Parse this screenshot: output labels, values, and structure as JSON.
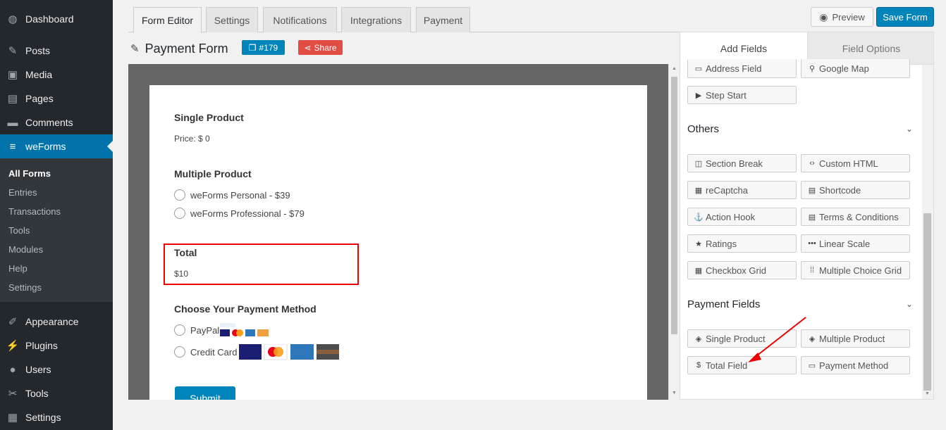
{
  "sidebar": {
    "items": [
      {
        "label": "Dashboard",
        "icon": "dashboard-icon",
        "glyph": "◍"
      },
      {
        "label": "Posts",
        "icon": "pin-icon",
        "glyph": "✎"
      },
      {
        "label": "Media",
        "icon": "media-icon",
        "glyph": "▣"
      },
      {
        "label": "Pages",
        "icon": "page-icon",
        "glyph": "▤"
      },
      {
        "label": "Comments",
        "icon": "comment-icon",
        "glyph": "▬"
      },
      {
        "label": "weForms",
        "icon": "weforms-icon",
        "glyph": "≡"
      }
    ],
    "submenu": [
      "All Forms",
      "Entries",
      "Transactions",
      "Tools",
      "Modules",
      "Help",
      "Settings"
    ],
    "lower_items": [
      {
        "label": "Appearance",
        "icon": "brush-icon",
        "glyph": "✐"
      },
      {
        "label": "Plugins",
        "icon": "plugin-icon",
        "glyph": "⚡"
      },
      {
        "label": "Users",
        "icon": "user-icon",
        "glyph": "●"
      },
      {
        "label": "Tools",
        "icon": "wrench-icon",
        "glyph": "✂"
      },
      {
        "label": "Settings",
        "icon": "settings-icon",
        "glyph": "▦"
      }
    ]
  },
  "tabs": [
    "Form Editor",
    "Settings",
    "Notifications",
    "Integrations",
    "Payment"
  ],
  "toolbar": {
    "preview_label": "Preview",
    "save_label": "Save Form"
  },
  "form": {
    "title": "Payment Form",
    "id_label": "#179",
    "share_label": "Share",
    "single_product_label": "Single Product",
    "price_label": "Price:",
    "price_value": "$ 0",
    "multiple_product_label": "Multiple Product",
    "options": [
      "weForms Personal - $39",
      "weForms Professional - $79"
    ],
    "total_label": "Total",
    "total_value": "$10",
    "payment_method_label": "Choose Your Payment Method",
    "paypal_label": "PayPal",
    "credit_card_label": "Credit Card",
    "submit_label": "Submit"
  },
  "panel": {
    "tab_add": "Add Fields",
    "tab_options": "Field Options",
    "top_fields": [
      "Address Field",
      "Google Map",
      "Step Start"
    ],
    "others_title": "Others",
    "others_fields": [
      "Section Break",
      "Custom HTML",
      "reCaptcha",
      "Shortcode",
      "Action Hook",
      "Terms & Conditions",
      "Ratings",
      "Linear Scale",
      "Checkbox Grid",
      "Multiple Choice Grid"
    ],
    "payment_title": "Payment Fields",
    "payment_fields": [
      "Single Product",
      "Multiple Product",
      "Total Field",
      "Payment Method"
    ]
  },
  "colors": {
    "accent": "#0085ba",
    "sidebar": "#23282d",
    "highlight": "#e00000",
    "share": "#e14d43"
  }
}
